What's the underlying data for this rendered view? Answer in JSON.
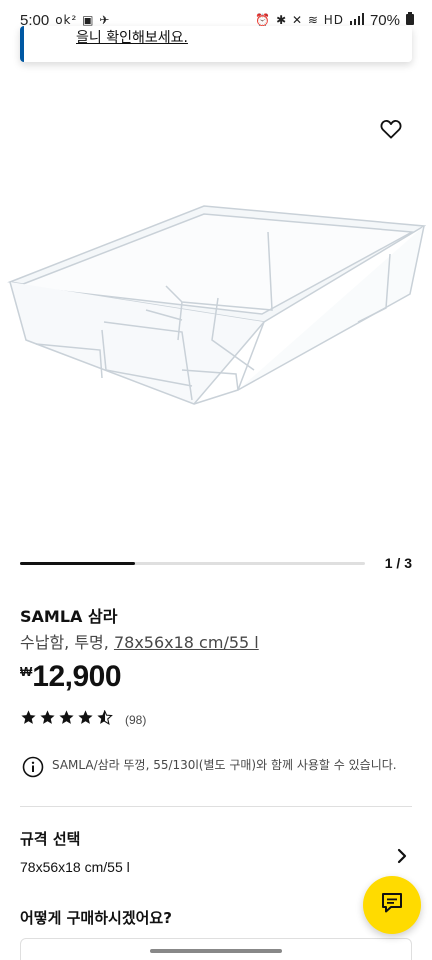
{
  "status_bar": {
    "time": "5:00",
    "left_icons": "ok² ▣ ✈",
    "right_icons": "⏰ ✱ ✕ ≋ HD",
    "battery": "70%"
  },
  "notice": {
    "text": "을니 확인해보세요."
  },
  "gallery": {
    "counter": "1 / 3",
    "progress": 0.333
  },
  "product": {
    "name": "SAMLA 삼라",
    "desc_prefix": "수납함, 투명, ",
    "size_link": "78x56x18 cm/55 l",
    "currency": "₩",
    "price": "12,900",
    "rating": 4.5,
    "review_count": "(98)"
  },
  "info": {
    "text": "SAMLA/삼라 뚜껑, 55/130l(별도 구매)와 함께 사용할 수 있습니다."
  },
  "spec": {
    "title": "규격 선택",
    "value": "78x56x18 cm/55 l"
  },
  "purchase": {
    "title": "어떻게 구매하시겠어요?"
  },
  "icons": {
    "wishlist": "heart-icon",
    "info": "info-icon",
    "chevron": "chevron-right-icon",
    "chat": "chat-icon",
    "star": "star-icon"
  },
  "colors": {
    "accent_blue": "#0058a3",
    "chat_yellow": "#ffdb00",
    "text": "#111111",
    "muted": "#484848"
  }
}
